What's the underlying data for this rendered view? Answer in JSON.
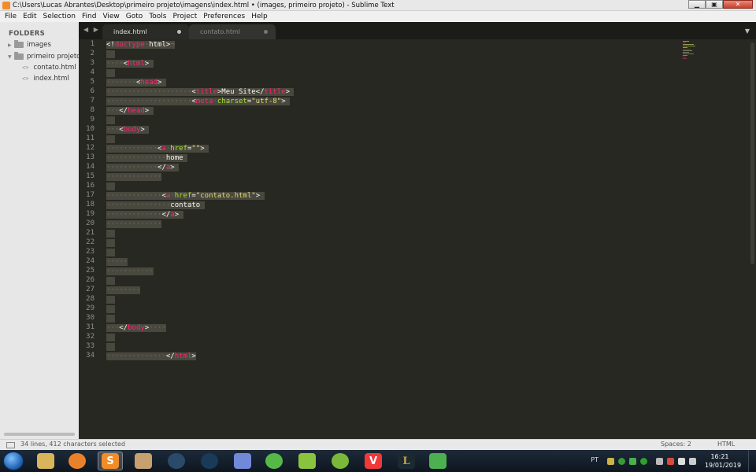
{
  "window": {
    "title": "C:\\Users\\Lucas Abrantes\\Desktop\\primeiro projeto\\imagens\\index.html • (images, primeiro projeto) - Sublime Text",
    "minimize": "▁",
    "maximize": "▣",
    "close": "✕"
  },
  "menu": [
    "File",
    "Edit",
    "Selection",
    "Find",
    "View",
    "Goto",
    "Tools",
    "Project",
    "Preferences",
    "Help"
  ],
  "sidebar": {
    "title": "FOLDERS",
    "items": [
      {
        "label": "images",
        "kind": "folder",
        "expanded": false
      },
      {
        "label": "primeiro projeto",
        "kind": "folder",
        "expanded": true
      },
      {
        "label": "contato.html",
        "kind": "file"
      },
      {
        "label": "index.html",
        "kind": "file"
      }
    ],
    "file_glyph": "<>"
  },
  "tabs": {
    "nav": "◀ ▶",
    "items": [
      {
        "label": "index.html",
        "active": true,
        "modified": true
      },
      {
        "label": "contato.html",
        "active": false,
        "modified": true
      }
    ],
    "menu_icon": "▼"
  },
  "editor": {
    "line_numbers": [
      "1",
      "2",
      "3",
      "4",
      "5",
      "6",
      "7",
      "8",
      "9",
      "10",
      "11",
      "12",
      "13",
      "14",
      "15",
      "16",
      "17",
      "18",
      "19",
      "20",
      "21",
      "22",
      "23",
      "24",
      "25",
      "26",
      "27",
      "28",
      "29",
      "30",
      "31",
      "32",
      "33",
      "34"
    ]
  },
  "statusbar": {
    "selection_info": "34 lines, 412 characters selected",
    "spaces": "Spaces: 2",
    "syntax": "HTML"
  },
  "taskbar": {
    "apps": [
      "explorer-icon",
      "media-player-icon",
      "sublime-text-icon",
      "game-icon",
      "steam-alt-icon",
      "steam-icon",
      "discord-icon",
      "utorrent-icon",
      "android-icon",
      "android-2-icon",
      "vivaldi-icon",
      "league-icon",
      "bluestacks-icon"
    ],
    "language": "PT",
    "time": "16:21",
    "date": "19/01/2019"
  },
  "colors": {
    "editor_bg": "#272822",
    "tag": "#f92672",
    "attr": "#a6e22e",
    "string": "#e6db74",
    "selection": "#49483e"
  }
}
